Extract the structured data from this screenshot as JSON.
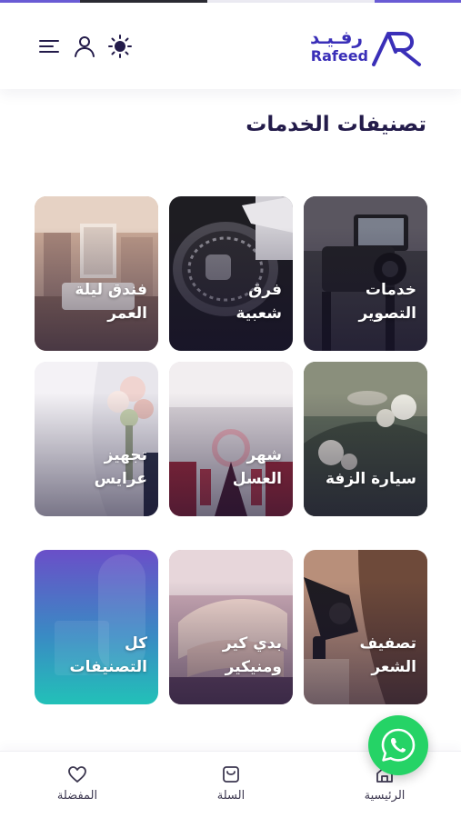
{
  "header": {
    "logo_ar": "رفـيـد",
    "logo_en": "Rafeed",
    "icons": [
      "menu-icon",
      "user-icon",
      "sun-icon"
    ]
  },
  "title": "تصنيفات الخدمات",
  "tiles": [
    {
      "line1": "خدمات",
      "line2": "التصوير"
    },
    {
      "line1": "فرق",
      "line2": "شعبية"
    },
    {
      "line1": "فندق ليلة",
      "line2": "العمر"
    },
    {
      "line1": "سيارة الزفة",
      "line2": ""
    },
    {
      "line1": "شهر",
      "line2": "العسل"
    },
    {
      "line1": "تجهيز",
      "line2": "عرايس"
    },
    {
      "line1": "تصفيف",
      "line2": "الشعر"
    },
    {
      "line1": "بدي كير",
      "line2": "ومنيكير"
    },
    {
      "line1": "كل",
      "line2": "التصنيفات"
    }
  ],
  "nav": {
    "home": "الرئيسية",
    "cart": "السلة",
    "favorites": "المفضلة"
  },
  "colors": {
    "brand": "#3a2fb8",
    "title": "#231b4a",
    "whatsapp": "#25d366"
  }
}
